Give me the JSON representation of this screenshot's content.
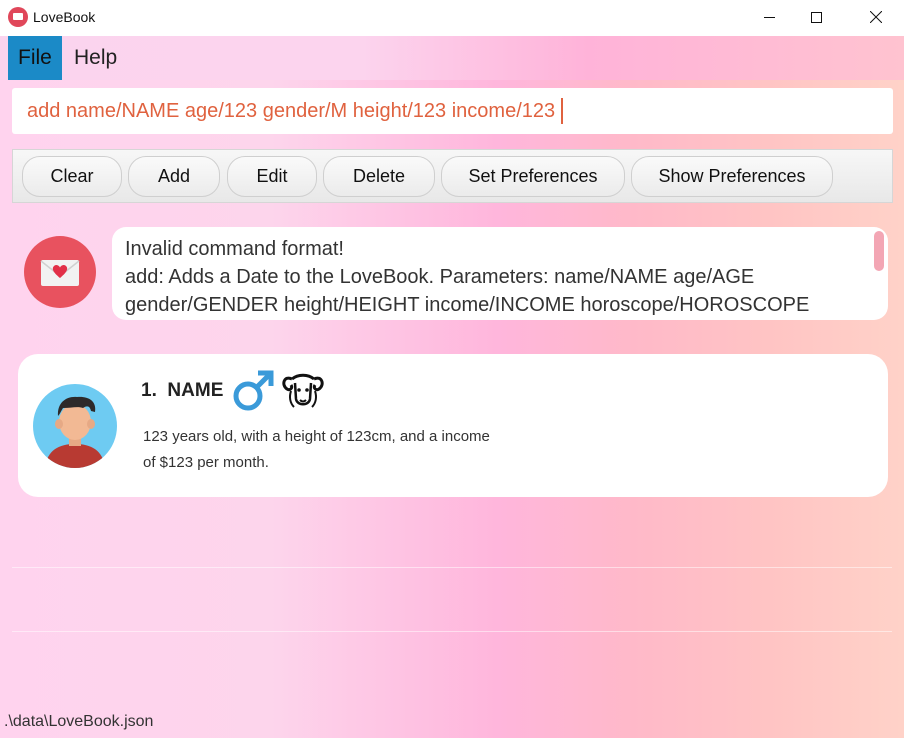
{
  "window": {
    "title": "LoveBook",
    "minimize_icon": "minimize-icon",
    "maximize_icon": "maximize-icon",
    "close_icon": "close-icon"
  },
  "menu": {
    "items": [
      {
        "label": "File",
        "selected": true
      },
      {
        "label": "Help",
        "selected": false
      }
    ]
  },
  "command_box": {
    "value": "add name/NAME age/123 gender/M height/123 income/123"
  },
  "toolbar": {
    "buttons": [
      {
        "label": "Clear"
      },
      {
        "label": "Add"
      },
      {
        "label": "Edit"
      },
      {
        "label": "Delete"
      },
      {
        "label": "Set Preferences"
      },
      {
        "label": "Show Preferences"
      }
    ]
  },
  "result": {
    "icon": "envelope-heart-icon",
    "lines": [
      "Invalid command format!",
      "add: Adds a Date to the LoveBook. Parameters: name/NAME age/AGE",
      "gender/GENDER height/HEIGHT income/INCOME horoscope/HOROSCOPE"
    ]
  },
  "date_card": {
    "index": "1.",
    "name": "NAME",
    "gender_icon": "male-symbol-icon",
    "horoscope_icon": "aries-ram-icon",
    "avatar_icon": "male-avatar-icon",
    "description_line1": "123 years old, with a height of 123cm, and a income",
    "description_line2": "of $123 per month."
  },
  "status": {
    "path": ".\\data\\LoveBook.json"
  },
  "colors": {
    "accent": "#1b8ac7",
    "command_text": "#e0623f",
    "envelope_circle": "#e8525f",
    "male_symbol": "#3a9ad9"
  }
}
